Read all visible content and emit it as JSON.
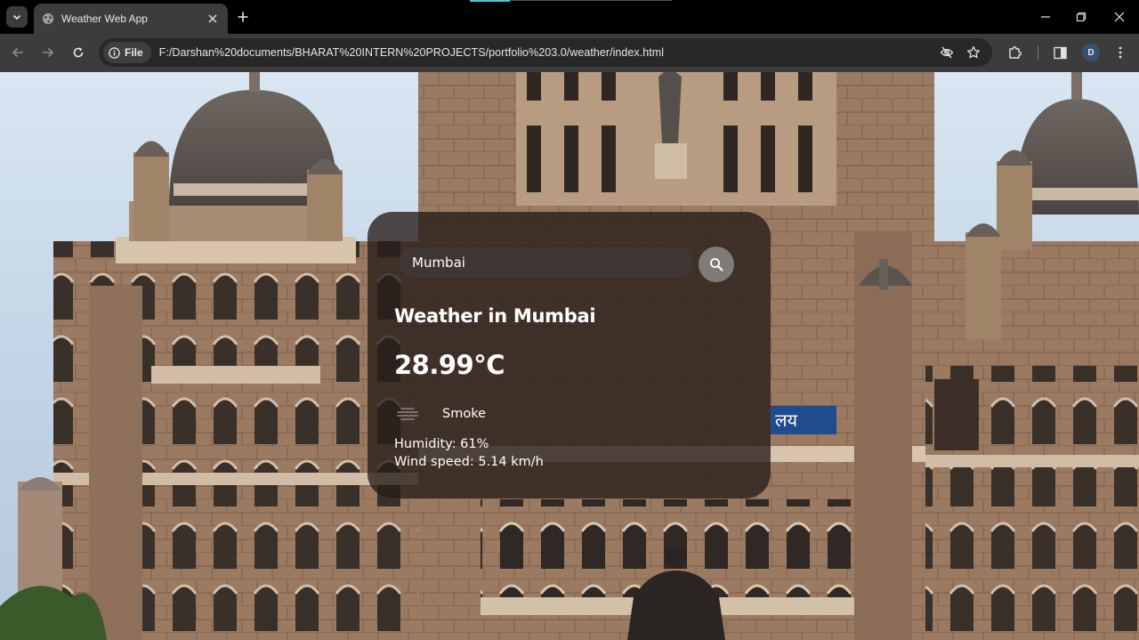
{
  "browser": {
    "tab_title": "Weather Web App",
    "site_chip_label": "File",
    "url": "F:/Darshan%20documents/BHARAT%20INTERN%20PROJECTS/portfolio%203.0/weather/index.html",
    "profile_initial": "D"
  },
  "weather": {
    "search_value": "Mumbai",
    "heading": "Weather in Mumbai",
    "temperature": "28.99°C",
    "condition": "Smoke",
    "condition_icon": "haze-icon",
    "humidity": "Humidity: 61%",
    "wind": "Wind speed: 5.14 km/h"
  },
  "background": {
    "sign_text": "लय"
  },
  "colors": {
    "card_bg": "#261c18",
    "search_button": "#7f7b78",
    "chrome_toolbar": "#3c3c3c",
    "tab_accent": "#49c9d6"
  }
}
